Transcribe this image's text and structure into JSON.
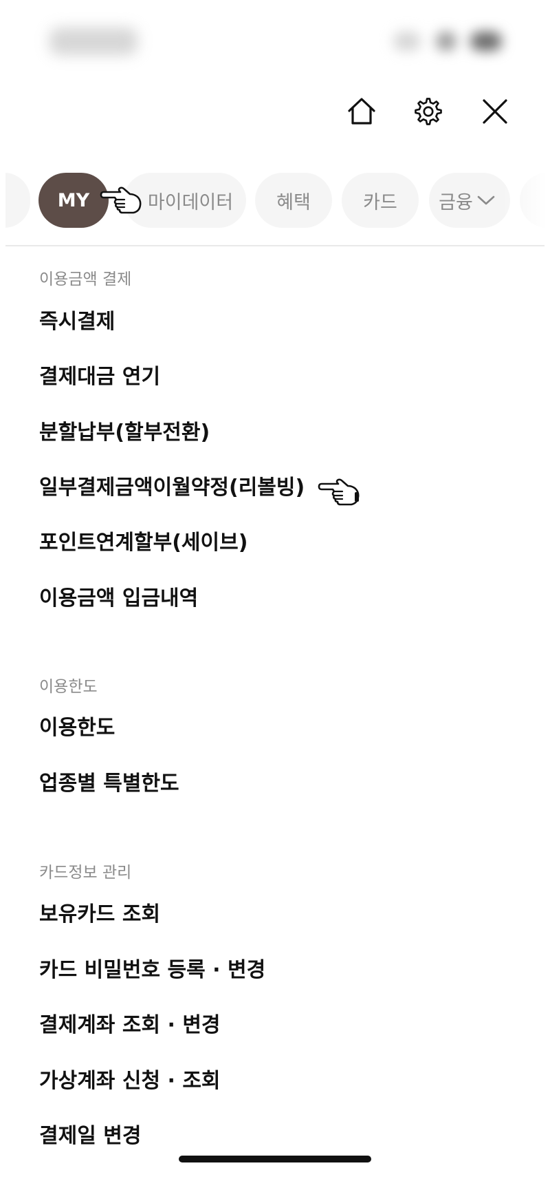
{
  "tabs": [
    {
      "label": "",
      "name": "tab-partial-left"
    },
    {
      "label": "MY",
      "selected": true
    },
    {
      "label": "마이데이터"
    },
    {
      "label": "혜택"
    },
    {
      "label": "카드"
    },
    {
      "label": "금융"
    },
    {
      "label": "",
      "name": "tab-partial-right"
    }
  ],
  "toolbar": {
    "home_icon": "home-icon",
    "settings_icon": "gear-icon",
    "close_icon": "close-icon"
  },
  "sections": [
    {
      "title": "이용금액 결제",
      "items": [
        "즉시결제",
        "결제대금 연기",
        "분할납부(할부전환)",
        "일부결제금액이월약정(리볼빙)",
        "포인트연계할부(세이브)",
        "이용금액 입금내역"
      ]
    },
    {
      "title": "이용한도",
      "items": [
        "이용한도",
        "업종별 특별한도"
      ]
    },
    {
      "title": "카드정보 관리",
      "items": [
        "보유카드 조회",
        "카드 비밀번호 등록 · 변경",
        "결제계좌 조회 · 변경",
        "가상계좌 신청 · 조회",
        "결제일 변경"
      ]
    }
  ],
  "colors": {
    "selected_tab": "#5d4d48",
    "tab_bg": "#f5f5f5",
    "muted_text": "#8a8a8a",
    "text": "#111111"
  }
}
